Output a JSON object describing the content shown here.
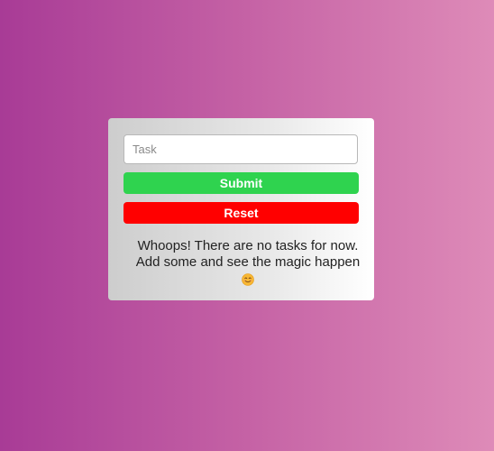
{
  "form": {
    "task_placeholder": "Task",
    "task_value": "",
    "submit_label": "Submit",
    "reset_label": "Reset"
  },
  "empty_state": {
    "line1": "Whoops! There are no tasks for now.",
    "line2": "Add some and see the magic happen",
    "emoji_icon": "smiling-face-icon"
  },
  "colors": {
    "background_start": "#a83b96",
    "background_end": "#de8bb8",
    "submit": "#2fd34f",
    "reset": "#ff0000"
  }
}
